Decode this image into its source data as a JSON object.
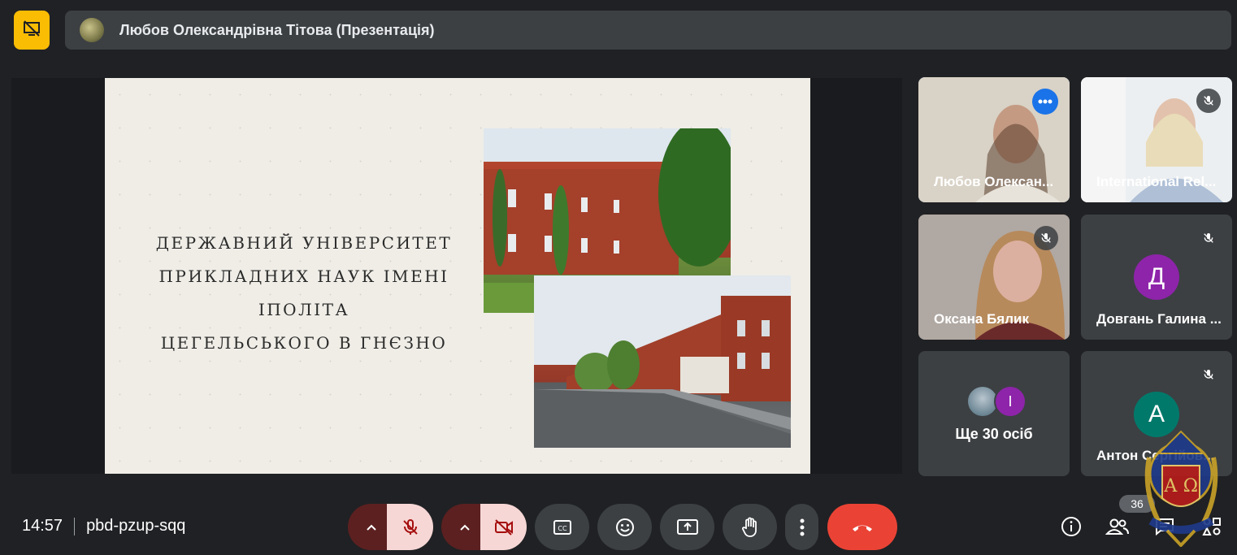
{
  "presenter": {
    "label": "Любов Олександрівна Тітова (Презентація)"
  },
  "slide": {
    "title_lines": [
      "Державний університет",
      "прикладних наук імені Іполіта",
      "Цегельського в Гнєзно"
    ]
  },
  "participants": [
    {
      "name": "Любов Олексан...",
      "active": true
    },
    {
      "name": "International Rel...",
      "muted": true
    },
    {
      "name": "Оксана Бялик",
      "muted": true
    },
    {
      "name": "Довгань Галина ...",
      "initial": "Д",
      "avatar_color": "#8e24aa",
      "muted": true
    },
    {
      "more_label": "Ще 30 осіб",
      "more_initial": "I"
    },
    {
      "name": "Антон Сергійов...",
      "initial": "А",
      "avatar_color": "#00796b",
      "muted": true
    }
  ],
  "meeting": {
    "time": "14:57",
    "code": "pbd-pzup-sqq"
  },
  "people_count": "36",
  "controls": [
    "mic-caret",
    "mic-off",
    "camera-caret",
    "camera-off",
    "captions",
    "emoji",
    "present",
    "raise-hand",
    "more-options",
    "leave-call"
  ],
  "crest": {
    "letters": "А Ω"
  },
  "colors": {
    "accent": "#fbbc04",
    "hangup": "#ea4335",
    "active_border": "#8ab4f8"
  }
}
